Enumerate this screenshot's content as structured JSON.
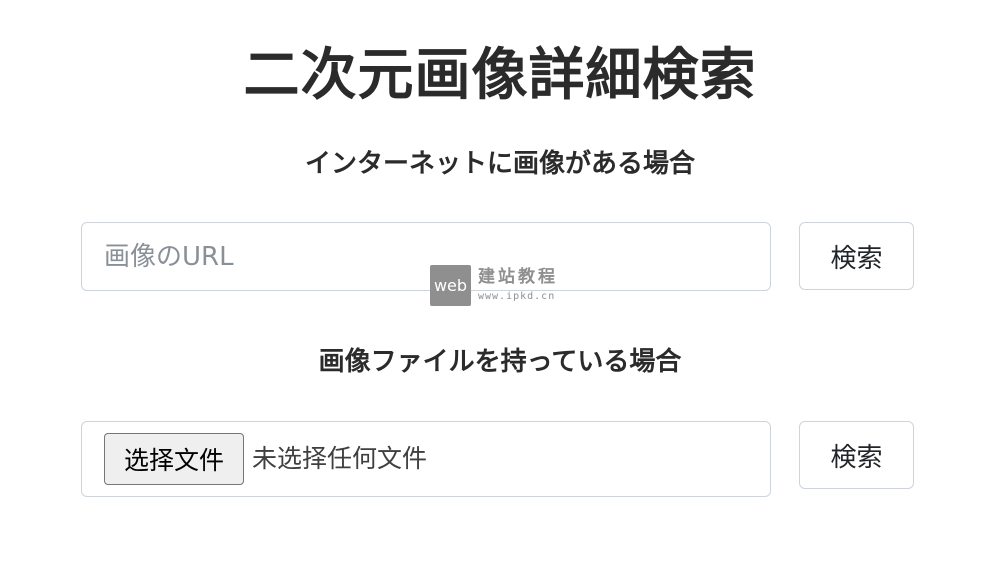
{
  "page": {
    "title": "二次元画像詳細検索"
  },
  "url_section": {
    "heading": "インターネットに画像がある場合",
    "input_placeholder": "画像のURL",
    "input_value": "",
    "search_label": "検索"
  },
  "file_section": {
    "heading": "画像ファイルを持っている場合",
    "choose_label": "选择文件",
    "status_text": "未选择任何文件",
    "search_label": "検索"
  },
  "watermark": {
    "logo_text": "web",
    "title": "建站教程",
    "url": "www.ipkd.cn"
  },
  "colors": {
    "text": "#2b2b2b",
    "border": "#ced4da",
    "placeholder": "#8a9097",
    "file_button_bg": "#efefef",
    "watermark": "#8f8f8f"
  }
}
